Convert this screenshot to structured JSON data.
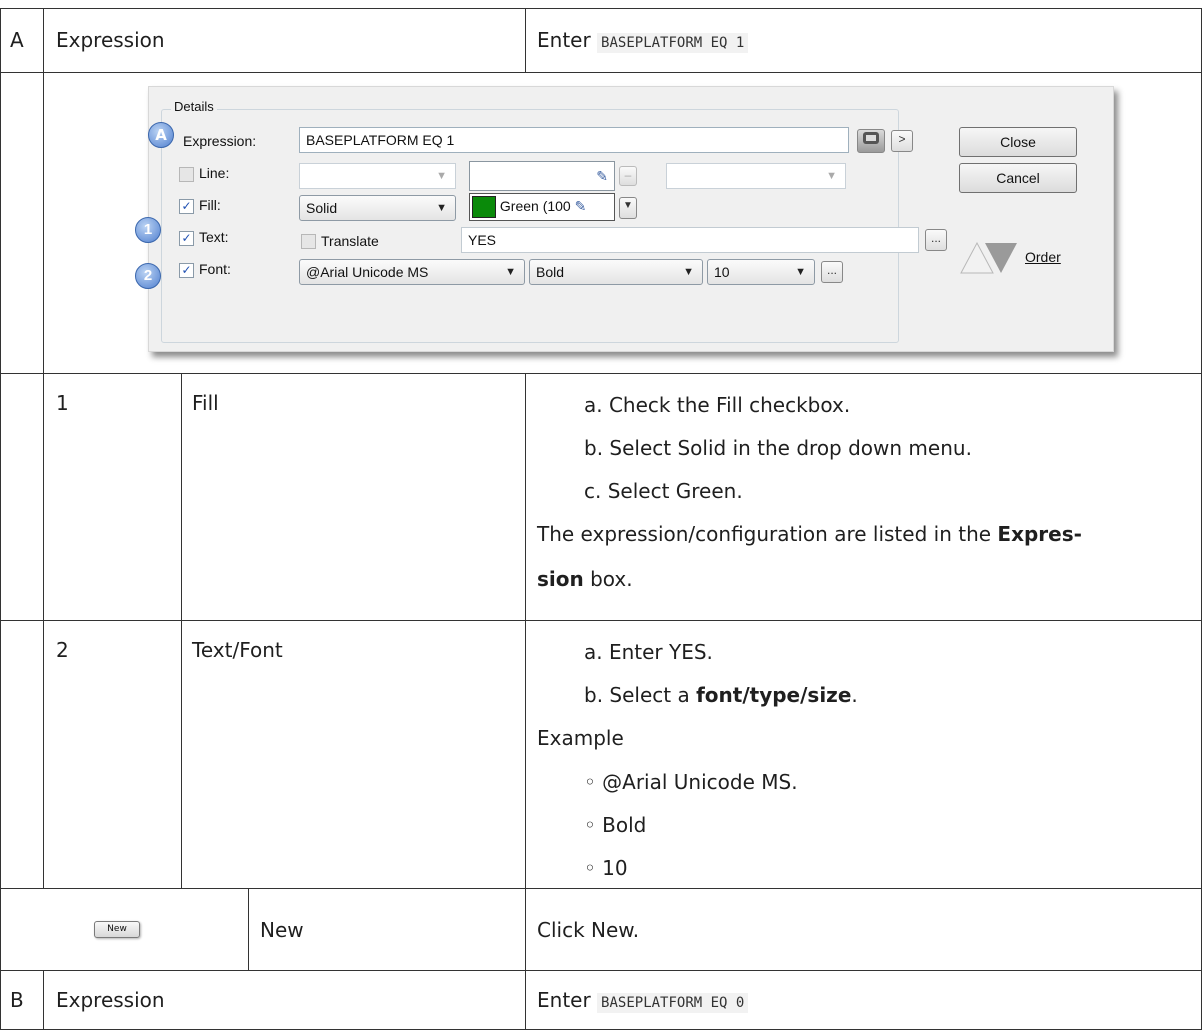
{
  "rows": {
    "a": {
      "letter": "A",
      "label": "Expression",
      "action_prefix": "Enter",
      "code": "BASEPLATFORM EQ 1"
    },
    "step1": {
      "number": "1",
      "label": "Fill",
      "steps": [
        "a. Check the Fill checkbox.",
        "b. Select Solid in the drop down menu.",
        "c. Select Green."
      ],
      "note_before": "The expression/configuration are listed in the",
      "note_bold_1": "Expres-",
      "note_bold_2": "sion",
      "note_after": "box."
    },
    "step2": {
      "number": "2",
      "label": "Text/Font",
      "step_a": "a. Enter YES.",
      "step_b_prefix": "b. Select a",
      "step_b_bold": "font/type/size",
      "step_b_suffix": ".",
      "example_label": "Example",
      "examples": [
        "◦ @Arial Unicode MS.",
        "◦ Bold",
        "◦ 10"
      ]
    },
    "new_row": {
      "button_label": "New",
      "label": "New",
      "action": "Click New."
    },
    "b": {
      "letter": "B",
      "label": "Expression",
      "action_prefix": "Enter",
      "code": "BASEPLATFORM EQ 0"
    }
  },
  "dialog": {
    "group_title": "Details",
    "expression_label": "Expression:",
    "expression_value": "BASEPLATFORM EQ 1",
    "line_label": "Line:",
    "fill_label": "Fill:",
    "fill_style": "Solid",
    "fill_color_text": "Green (100",
    "fill_color": "#0a8a0a",
    "text_label": "Text:",
    "translate_label": "Translate",
    "text_value": "YES",
    "font_label": "Font:",
    "font_name": "@Arial Unicode MS",
    "font_weight": "Bold",
    "font_size": "10",
    "ellipsis": "...",
    "expand_glyph": ">",
    "close_label": "Close",
    "cancel_label": "Cancel",
    "order_label": "Order",
    "badge_a": "A",
    "badge_1": "1",
    "badge_2": "2",
    "checked_fill": true,
    "checked_text": true,
    "checked_font": true,
    "checked_line": false,
    "checked_translate": false
  }
}
